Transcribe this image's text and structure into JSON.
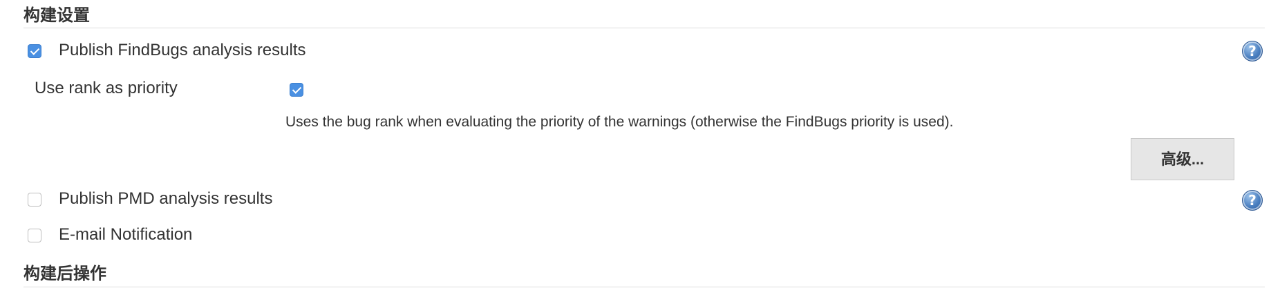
{
  "sections": {
    "build_settings": "构建设置",
    "post_build": "构建后操作"
  },
  "findbugs": {
    "checked": true,
    "label": "Publish FindBugs analysis results",
    "help_icon": "question-mark-icon",
    "use_rank": {
      "label": "Use rank as priority",
      "checked": true,
      "description": "Uses the bug rank when evaluating the priority of the warnings (otherwise the FindBugs priority is used)."
    },
    "advanced_button": "高级..."
  },
  "pmd": {
    "checked": false,
    "label": "Publish PMD analysis results",
    "help_icon": "question-mark-icon"
  },
  "email": {
    "checked": false,
    "label": "E-mail Notification"
  },
  "colors": {
    "checkbox_checked": "#4a90e2",
    "help_icon": "#4a7fc0",
    "button_bg": "#e6e6e6"
  }
}
